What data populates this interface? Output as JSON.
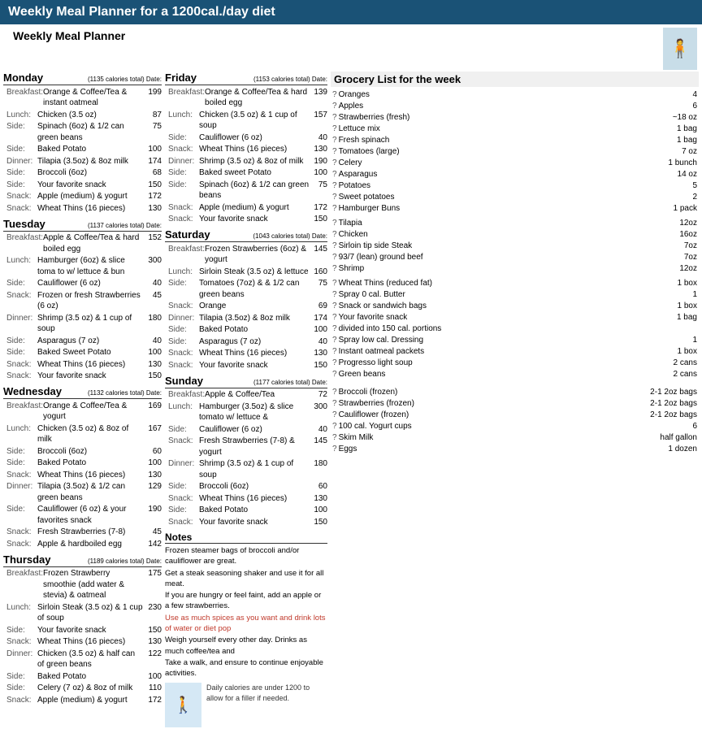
{
  "header": {
    "banner": "Weekly Meal Planner for a 1200cal./day diet",
    "page_title": "Weekly Meal Planner"
  },
  "days": {
    "monday": {
      "name": "Monday",
      "calories": "(1135 calories total)",
      "date_label": "Date:",
      "meals": [
        {
          "label": "Breakfast:",
          "name": "Orange & Coffee/Tea & instant oatmeal",
          "cal": "199"
        },
        {
          "label": "Lunch:",
          "name": "Chicken (3.5 oz)",
          "cal": "87"
        },
        {
          "label": "Side:",
          "name": "Spinach (6oz) & 1/2 can green beans",
          "cal": "75"
        },
        {
          "label": "Side:",
          "name": "Baked Potato",
          "cal": "100"
        },
        {
          "label": "Dinner:",
          "name": "Tilapia (3.5oz) & 8oz milk",
          "cal": "174"
        },
        {
          "label": "Side:",
          "name": "Broccoli (6oz)",
          "cal": "68"
        },
        {
          "label": "Side:",
          "name": "Your favorite snack",
          "cal": "150"
        },
        {
          "label": "Snack:",
          "name": "Apple (medium) & yogurt",
          "cal": "172"
        },
        {
          "label": "Snack:",
          "name": "Wheat Thins (16 pieces)",
          "cal": "130"
        }
      ]
    },
    "tuesday": {
      "name": "Tuesday",
      "calories": "(1137 calories total)",
      "date_label": "Date:",
      "meals": [
        {
          "label": "Breakfast:",
          "name": "Apple & Coffee/Tea & hard boiled egg",
          "cal": "152"
        },
        {
          "label": "Lunch:",
          "name": "Hamburger (6oz) & slice toma to w/ lettuce & bun",
          "cal": "300"
        },
        {
          "label": "Side:",
          "name": "Cauliflower (6 oz)",
          "cal": "40"
        },
        {
          "label": "Snack:",
          "name": "Frozen or fresh Strawberries (6 oz)",
          "cal": "45"
        },
        {
          "label": "Dinner:",
          "name": "Shrimp (3.5 oz) & 1 cup of soup",
          "cal": "180"
        },
        {
          "label": "Side:",
          "name": "Asparagus (7 oz)",
          "cal": "40"
        },
        {
          "label": "Side:",
          "name": "Baked Sweet Potato",
          "cal": "100"
        },
        {
          "label": "Snack:",
          "name": "Wheat Thins (16 pieces)",
          "cal": "130"
        },
        {
          "label": "Snack:",
          "name": "Your favorite snack",
          "cal": "150"
        }
      ]
    },
    "wednesday": {
      "name": "Wednesday",
      "calories": "(1132 calories total)",
      "date_label": "Date:",
      "meals": [
        {
          "label": "Breakfast:",
          "name": "Orange & Coffee/Tea & yogurt",
          "cal": "169"
        },
        {
          "label": "Lunch:",
          "name": "Chicken (3.5 oz) & 8oz of milk",
          "cal": "167"
        },
        {
          "label": "Side:",
          "name": "Broccoli (6oz)",
          "cal": "60"
        },
        {
          "label": "Side:",
          "name": "Baked Potato",
          "cal": "100"
        },
        {
          "label": "Snack:",
          "name": "Wheat Thins (16 pieces)",
          "cal": "130"
        },
        {
          "label": "Dinner:",
          "name": "Tilapia (3.5oz) & 1/2 can green beans",
          "cal": "129"
        },
        {
          "label": "Side:",
          "name": "Cauliflower (6 oz) & your favorites snack",
          "cal": "190"
        },
        {
          "label": "Snack:",
          "name": "Fresh Strawberries (7-8)",
          "cal": "45"
        },
        {
          "label": "Snack:",
          "name": "Apple & hardboiled egg",
          "cal": "142"
        }
      ]
    },
    "thursday": {
      "name": "Thursday",
      "calories": "(1189 calories total)",
      "date_label": "Date:",
      "meals": [
        {
          "label": "Breakfast:",
          "name": "Frozen Strawberry smoothie (add water & stevia) & oatmeal",
          "cal": "175"
        },
        {
          "label": "Lunch:",
          "name": "Sirloin Steak (3.5 oz) & 1 cup of soup",
          "cal": "230"
        },
        {
          "label": "Side:",
          "name": "Your favorite snack",
          "cal": "150"
        },
        {
          "label": "Snack:",
          "name": "Wheat Thins (16 pieces)",
          "cal": "130"
        },
        {
          "label": "Dinner:",
          "name": "Chicken (3.5 oz) & half can of green beans",
          "cal": "122"
        },
        {
          "label": "Side:",
          "name": "Baked Potato",
          "cal": "100"
        },
        {
          "label": "Side:",
          "name": "Celery (7 oz) & 8oz of milk",
          "cal": "110"
        },
        {
          "label": "Snack:",
          "name": "Apple (medium) & yogurt",
          "cal": "172"
        }
      ]
    },
    "friday": {
      "name": "Friday",
      "calories": "(1153 calories total)",
      "date_label": "Date:",
      "meals": [
        {
          "label": "Breakfast:",
          "name": "Orange & Coffee/Tea & hard boiled egg",
          "cal": "139"
        },
        {
          "label": "Lunch:",
          "name": "Chicken (3.5 oz) & 1 cup of soup",
          "cal": "157"
        },
        {
          "label": "Side:",
          "name": "Cauliflower (6 oz)",
          "cal": "40"
        },
        {
          "label": "Snack:",
          "name": "Wheat Thins (16 pieces)",
          "cal": "130"
        },
        {
          "label": "Dinner:",
          "name": "Shrimp (3.5 oz) & 8oz of milk",
          "cal": "190"
        },
        {
          "label": "Side:",
          "name": "Baked sweet Potato",
          "cal": "100"
        },
        {
          "label": "Side:",
          "name": "Spinach (6oz) & 1/2 can green beans",
          "cal": "75"
        },
        {
          "label": "Snack:",
          "name": "Apple (medium) & yogurt",
          "cal": "172"
        },
        {
          "label": "Snack:",
          "name": "Your favorite snack",
          "cal": "150"
        }
      ]
    },
    "saturday": {
      "name": "Saturday",
      "calories": "(1043 calories total)",
      "date_label": "Date:",
      "meals": [
        {
          "label": "Breakfast:",
          "name": "Frozen Strawberries (6oz) & yogurt",
          "cal": "145"
        },
        {
          "label": "Lunch:",
          "name": "Sirloin Steak (3.5 oz) & lettuce",
          "cal": "160"
        },
        {
          "label": "Side:",
          "name": "Tomatoes (7oz) & & 1/2 can green beans",
          "cal": "75"
        },
        {
          "label": "Snack:",
          "name": "Orange",
          "cal": "69"
        },
        {
          "label": "Dinner:",
          "name": "Tilapia (3.5oz) & 8oz milk",
          "cal": "174"
        },
        {
          "label": "Side:",
          "name": "Baked Potato",
          "cal": "100"
        },
        {
          "label": "Side:",
          "name": "Asparagus (7 oz)",
          "cal": "40"
        },
        {
          "label": "Snack:",
          "name": "Wheat Thins (16 pieces)",
          "cal": "130"
        },
        {
          "label": "Snack:",
          "name": "Your favorite snack",
          "cal": "150"
        }
      ]
    },
    "sunday": {
      "name": "Sunday",
      "calories": "(1177 calories total)",
      "date_label": "Date:",
      "meals": [
        {
          "label": "Breakfast:",
          "name": "Apple & Coffee/Tea",
          "cal": "72"
        },
        {
          "label": "Lunch:",
          "name": "Hamburger (3.5oz) & slice tomato w/ lettuce &",
          "cal": "300"
        },
        {
          "label": "Side:",
          "name": "Cauliflower (6 oz)",
          "cal": "40"
        },
        {
          "label": "Snack:",
          "name": "Fresh Strawberries (7-8) & yogurt",
          "cal": "145"
        },
        {
          "label": "Dinner:",
          "name": "Shrimp (3.5 oz) & 1 cup of soup",
          "cal": "180"
        },
        {
          "label": "Side:",
          "name": "Broccoli (6oz)",
          "cal": "60"
        },
        {
          "label": "Snack:",
          "name": "Wheat Thins (16 pieces)",
          "cal": "130"
        },
        {
          "label": "Side:",
          "name": "Baked Potato",
          "cal": "100"
        },
        {
          "label": "Snack:",
          "name": "Your favorite snack",
          "cal": "150"
        }
      ]
    }
  },
  "grocery": {
    "title": "Grocery List for the week",
    "items": [
      {
        "name": "Oranges",
        "amt": "4"
      },
      {
        "name": "Apples",
        "amt": "6"
      },
      {
        "name": "Strawberries (fresh)",
        "amt": "~18 oz"
      },
      {
        "name": "Lettuce mix",
        "amt": "1 bag"
      },
      {
        "name": "Fresh spinach",
        "amt": "1 bag"
      },
      {
        "name": "Tomatoes (large)",
        "amt": "7 oz"
      },
      {
        "name": "Celery",
        "amt": "1 bunch"
      },
      {
        "name": "Asparagus",
        "amt": "14 oz"
      },
      {
        "name": "Potatoes",
        "amt": "5"
      },
      {
        "name": "Sweet potatoes",
        "amt": "2"
      },
      {
        "name": "Hamburger Buns",
        "amt": "1 pack"
      },
      {
        "name": "",
        "amt": ""
      },
      {
        "name": "Tilapia",
        "amt": "12oz"
      },
      {
        "name": "Chicken",
        "amt": "16oz"
      },
      {
        "name": "Sirloin tip side Steak",
        "amt": "7oz"
      },
      {
        "name": "93/7 (lean) ground beef",
        "amt": "7oz"
      },
      {
        "name": "Shrimp",
        "amt": "12oz"
      },
      {
        "name": "",
        "amt": ""
      },
      {
        "name": "Wheat Thins (reduced fat)",
        "amt": "1 box"
      },
      {
        "name": "Spray 0 cal. Butter",
        "amt": "1"
      },
      {
        "name": "Snack or sandwich bags",
        "amt": "1 box"
      },
      {
        "name": "Your favorite snack",
        "amt": "1 bag"
      },
      {
        "name": "        divided into 150 cal. portions",
        "amt": ""
      },
      {
        "name": "Spray low cal. Dressing",
        "amt": "1"
      },
      {
        "name": "Instant oatmeal packets",
        "amt": "1 box"
      },
      {
        "name": "Progresso light soup",
        "amt": "2 cans"
      },
      {
        "name": "Green beans",
        "amt": "2 cans"
      },
      {
        "name": "",
        "amt": ""
      },
      {
        "name": "",
        "amt": ""
      },
      {
        "name": "Broccoli (frozen)",
        "amt": "2-1 2oz bags"
      },
      {
        "name": "Strawberries (frozen)",
        "amt": "2-1 2oz bags"
      },
      {
        "name": "Cauliflower (frozen)",
        "amt": "2-1 2oz bags"
      },
      {
        "name": "100 cal. Yogurt cups",
        "amt": "6"
      },
      {
        "name": "Skim Milk",
        "amt": "half gallon"
      },
      {
        "name": "Eggs",
        "amt": "1 dozen"
      }
    ]
  },
  "notes": {
    "title": "Notes",
    "lines": [
      {
        "text": "Frozen steamer bags of broccoli and/or cauliflower are great.",
        "red": false
      },
      {
        "text": "Get a steak seasoning shaker and use it for all meat.",
        "red": false
      },
      {
        "text": "If you are hungry or feel faint, add an apple or a few strawberries.",
        "red": false
      },
      {
        "text": "Use as much spices as you want and drink lots of water or diet pop",
        "red": true
      },
      {
        "text": "Weigh yourself every other day. Drinks as much coffee/tea and",
        "red": false
      },
      {
        "text": "Take a walk, and ensure to continue enjoyable activities.",
        "red": false
      }
    ],
    "daily_note": "Daily calories are under 1200 to allow for a filler if needed."
  }
}
